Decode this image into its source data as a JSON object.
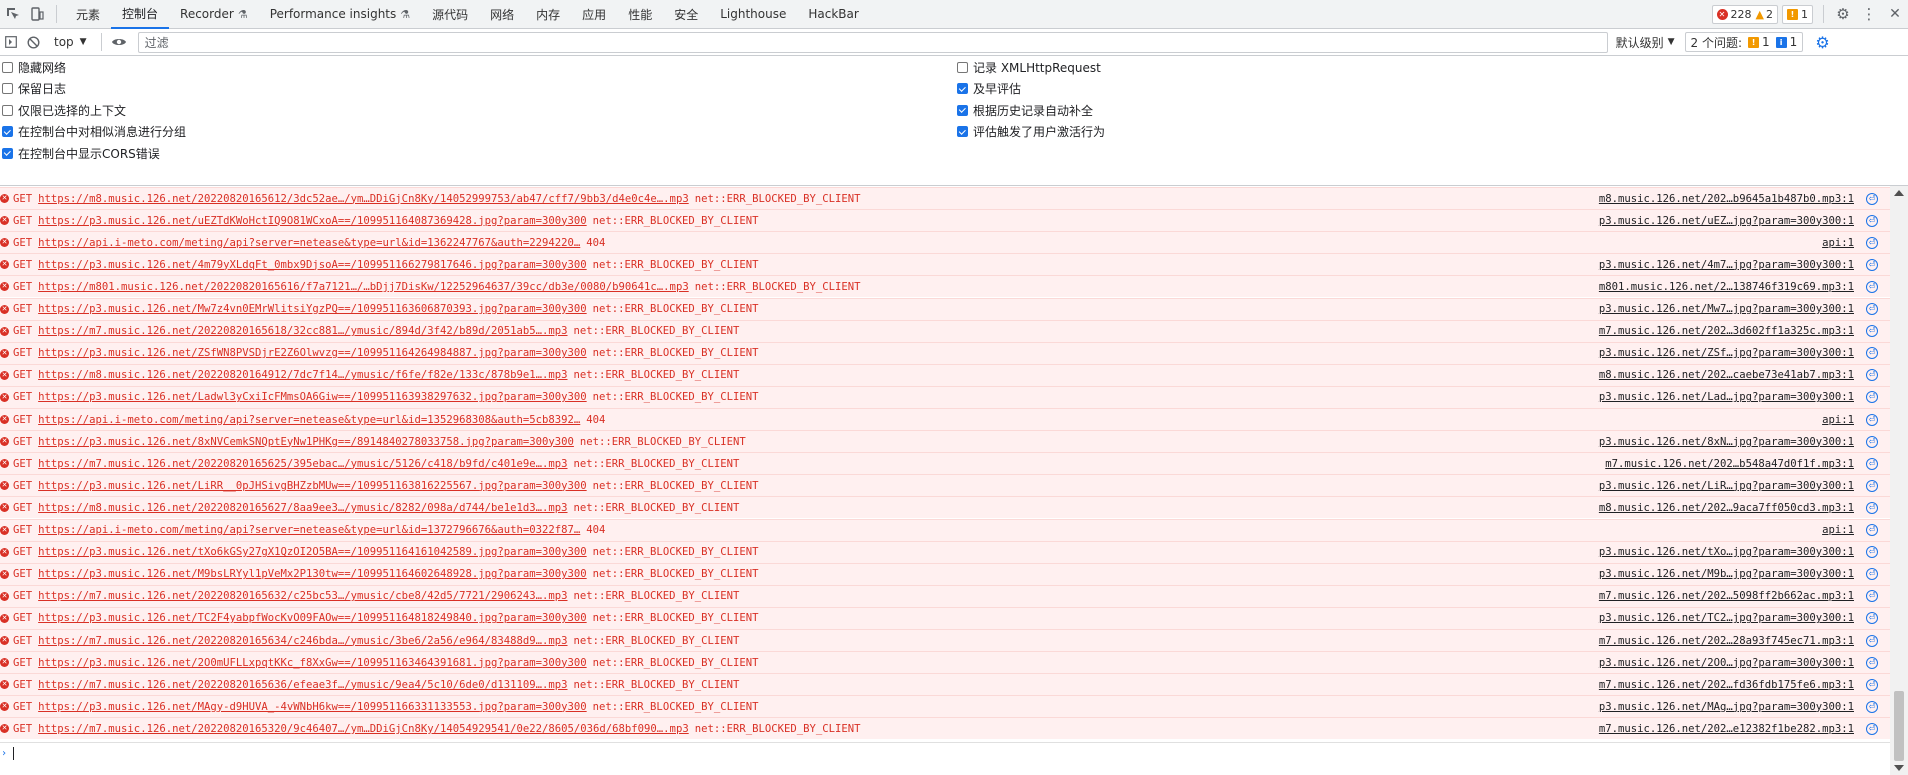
{
  "tabbar": {
    "tabs": [
      {
        "label": "元素",
        "active": false,
        "flask": false
      },
      {
        "label": "控制台",
        "active": true,
        "flask": false
      },
      {
        "label": "Recorder",
        "active": false,
        "flask": true
      },
      {
        "label": "Performance insights",
        "active": false,
        "flask": true
      },
      {
        "label": "源代码",
        "active": false,
        "flask": false
      },
      {
        "label": "网络",
        "active": false,
        "flask": false
      },
      {
        "label": "内存",
        "active": false,
        "flask": false
      },
      {
        "label": "应用",
        "active": false,
        "flask": false
      },
      {
        "label": "性能",
        "active": false,
        "flask": false
      },
      {
        "label": "安全",
        "active": false,
        "flask": false
      },
      {
        "label": "Lighthouse",
        "active": false,
        "flask": false
      },
      {
        "label": "HackBar",
        "active": false,
        "flask": false
      }
    ],
    "error_count": "228",
    "warning_count": "2",
    "issue_count": "1"
  },
  "toolbar": {
    "context": "top",
    "filter_placeholder": "过滤",
    "levels_label": "默认级别",
    "issues_label": "2 个问题:",
    "issues_warn": "1",
    "issues_info": "1"
  },
  "settings": {
    "left": [
      {
        "label": "隐藏网络",
        "checked": false
      },
      {
        "label": "保留日志",
        "checked": false
      },
      {
        "label": "仅限已选择的上下文",
        "checked": false
      },
      {
        "label": "在控制台中对相似消息进行分组",
        "checked": true
      },
      {
        "label": "在控制台中显示CORS错误",
        "checked": true
      }
    ],
    "right": [
      {
        "label": "记录 XMLHttpRequest",
        "checked": false
      },
      {
        "label": "及早评估",
        "checked": true
      },
      {
        "label": "根据历史记录自动补全",
        "checked": true
      },
      {
        "label": "评估触发了用户激活行为",
        "checked": true
      }
    ]
  },
  "log_rows": [
    {
      "method": "GET",
      "url": "https://m8.music.126.net/20220820165612/3dc52ae…/ym…DDiGjCn8Ky/14052999753/ab47/cff7/9bb3/d4e0c4e….mp3",
      "status": "net::ERR_BLOCKED_BY_CLIENT",
      "source": "m8.music.126.net/202…b9645a1b487b0.mp3:1"
    },
    {
      "method": "GET",
      "url": "https://p3.music.126.net/uEZTdKWoHctIQ9O81WCxoA==/109951164087369428.jpg?param=300y300",
      "status": "net::ERR_BLOCKED_BY_CLIENT",
      "source": "p3.music.126.net/uEZ…jpg?param=300y300:1"
    },
    {
      "method": "GET",
      "url": "https://api.i-meto.com/meting/api?server=netease&type=url&id=1362247767&auth=2294220…",
      "status": "404",
      "source": "api:1"
    },
    {
      "method": "GET",
      "url": "https://p3.music.126.net/4m79yXLdqFt_0mbx9DjsoA==/109951166279817646.jpg?param=300y300",
      "status": "net::ERR_BLOCKED_BY_CLIENT",
      "source": "p3.music.126.net/4m7…jpg?param=300y300:1"
    },
    {
      "method": "GET",
      "url": "https://m801.music.126.net/20220820165616/f7a7121…/…bDjj7DisKw/12252964637/39cc/db3e/0080/b90641c….mp3",
      "status": "net::ERR_BLOCKED_BY_CLIENT",
      "source": "m801.music.126.net/2…138746f319c69.mp3:1"
    },
    {
      "method": "GET",
      "url": "https://p3.music.126.net/Mw7z4vn0EMrWlitsiYgzPQ==/109951163606870393.jpg?param=300y300",
      "status": "net::ERR_BLOCKED_BY_CLIENT",
      "source": "p3.music.126.net/Mw7…jpg?param=300y300:1"
    },
    {
      "method": "GET",
      "url": "https://m7.music.126.net/20220820165618/32cc881…/ymusic/894d/3f42/b89d/2051ab5….mp3",
      "status": "net::ERR_BLOCKED_BY_CLIENT",
      "source": "m7.music.126.net/202…3d602ff1a325c.mp3:1"
    },
    {
      "method": "GET",
      "url": "https://p3.music.126.net/ZSfWN8PVSDjrE2Z6Olwvzg==/109951164264984887.jpg?param=300y300",
      "status": "net::ERR_BLOCKED_BY_CLIENT",
      "source": "p3.music.126.net/ZSf…jpg?param=300y300:1"
    },
    {
      "method": "GET",
      "url": "https://m8.music.126.net/20220820164912/7dc7f14…/ymusic/f6fe/f82e/133c/878b9e1….mp3",
      "status": "net::ERR_BLOCKED_BY_CLIENT",
      "source": "m8.music.126.net/202…caebe73e41ab7.mp3:1"
    },
    {
      "method": "GET",
      "url": "https://p3.music.126.net/Ladwl3yCxiIcFMmsOA6Giw==/109951163938297632.jpg?param=300y300",
      "status": "net::ERR_BLOCKED_BY_CLIENT",
      "source": "p3.music.126.net/Lad…jpg?param=300y300:1"
    },
    {
      "method": "GET",
      "url": "https://api.i-meto.com/meting/api?server=netease&type=url&id=1352968308&auth=5cb8392…",
      "status": "404",
      "source": "api:1"
    },
    {
      "method": "GET",
      "url": "https://p3.music.126.net/8xNVCemkSNQptEyNw1PHKg==/8914840278033758.jpg?param=300y300",
      "status": "net::ERR_BLOCKED_BY_CLIENT",
      "source": "p3.music.126.net/8xN…jpg?param=300y300:1"
    },
    {
      "method": "GET",
      "url": "https://m7.music.126.net/20220820165625/395ebac…/ymusic/5126/c418/b9fd/c401e9e….mp3",
      "status": "net::ERR_BLOCKED_BY_CLIENT",
      "source": "m7.music.126.net/202…b548a47d0f1f.mp3:1"
    },
    {
      "method": "GET",
      "url": "https://p3.music.126.net/LiRR__0pJHSivgBHZzbMUw==/109951163816225567.jpg?param=300y300",
      "status": "net::ERR_BLOCKED_BY_CLIENT",
      "source": "p3.music.126.net/LiR…jpg?param=300y300:1"
    },
    {
      "method": "GET",
      "url": "https://m8.music.126.net/20220820165627/8aa9ee3…/ymusic/8282/098a/d744/be1e1d3….mp3",
      "status": "net::ERR_BLOCKED_BY_CLIENT",
      "source": "m8.music.126.net/202…9aca7ff050cd3.mp3:1"
    },
    {
      "method": "GET",
      "url": "https://api.i-meto.com/meting/api?server=netease&type=url&id=1372796676&auth=0322f87…",
      "status": "404",
      "source": "api:1"
    },
    {
      "method": "GET",
      "url": "https://p3.music.126.net/tXo6kGSy27gX1QzOI2O5BA==/109951164161042589.jpg?param=300y300",
      "status": "net::ERR_BLOCKED_BY_CLIENT",
      "source": "p3.music.126.net/tXo…jpg?param=300y300:1"
    },
    {
      "method": "GET",
      "url": "https://p3.music.126.net/M9bsLRYyl1pVeMx2P130tw==/109951164602648928.jpg?param=300y300",
      "status": "net::ERR_BLOCKED_BY_CLIENT",
      "source": "p3.music.126.net/M9b…jpg?param=300y300:1"
    },
    {
      "method": "GET",
      "url": "https://m7.music.126.net/20220820165632/c25bc53…/ymusic/cbe8/42d5/7721/2906243….mp3",
      "status": "net::ERR_BLOCKED_BY_CLIENT",
      "source": "m7.music.126.net/202…5098ff2b662ac.mp3:1"
    },
    {
      "method": "GET",
      "url": "https://p3.music.126.net/TC2F4yabpfWocKvO09FAOw==/109951164818249840.jpg?param=300y300",
      "status": "net::ERR_BLOCKED_BY_CLIENT",
      "source": "p3.music.126.net/TC2…jpg?param=300y300:1"
    },
    {
      "method": "GET",
      "url": "https://m7.music.126.net/20220820165634/c246bda…/ymusic/3be6/2a56/e964/83488d9….mp3",
      "status": "net::ERR_BLOCKED_BY_CLIENT",
      "source": "m7.music.126.net/202…28a93f745ec71.mp3:1"
    },
    {
      "method": "GET",
      "url": "https://p3.music.126.net/2O0mUFLLxpqtKKc_f8XxGw==/109951163464391681.jpg?param=300y300",
      "status": "net::ERR_BLOCKED_BY_CLIENT",
      "source": "p3.music.126.net/2O0…jpg?param=300y300:1"
    },
    {
      "method": "GET",
      "url": "https://m7.music.126.net/20220820165636/efeae3f…/ymusic/9ea4/5c10/6de0/d131109….mp3",
      "status": "net::ERR_BLOCKED_BY_CLIENT",
      "source": "m7.music.126.net/202…fd36fdb175fe6.mp3:1"
    },
    {
      "method": "GET",
      "url": "https://p3.music.126.net/MAgy-d9HUVA_-4vWNbH6kw==/109951166331133553.jpg?param=300y300",
      "status": "net::ERR_BLOCKED_BY_CLIENT",
      "source": "p3.music.126.net/MAg…jpg?param=300y300:1"
    },
    {
      "method": "GET",
      "url": "https://m7.music.126.net/20220820165320/9c46407…/ym…DDiGjCn8Ky/14054929541/0e22/8605/036d/68bf090….mp3",
      "status": "net::ERR_BLOCKED_BY_CLIENT",
      "source": "m7.music.126.net/202…e12382f1be282.mp3:1"
    }
  ],
  "colors": {
    "error_red": "#d93025",
    "row_bg": "#fff0f0",
    "accent_blue": "#1a73e8"
  }
}
